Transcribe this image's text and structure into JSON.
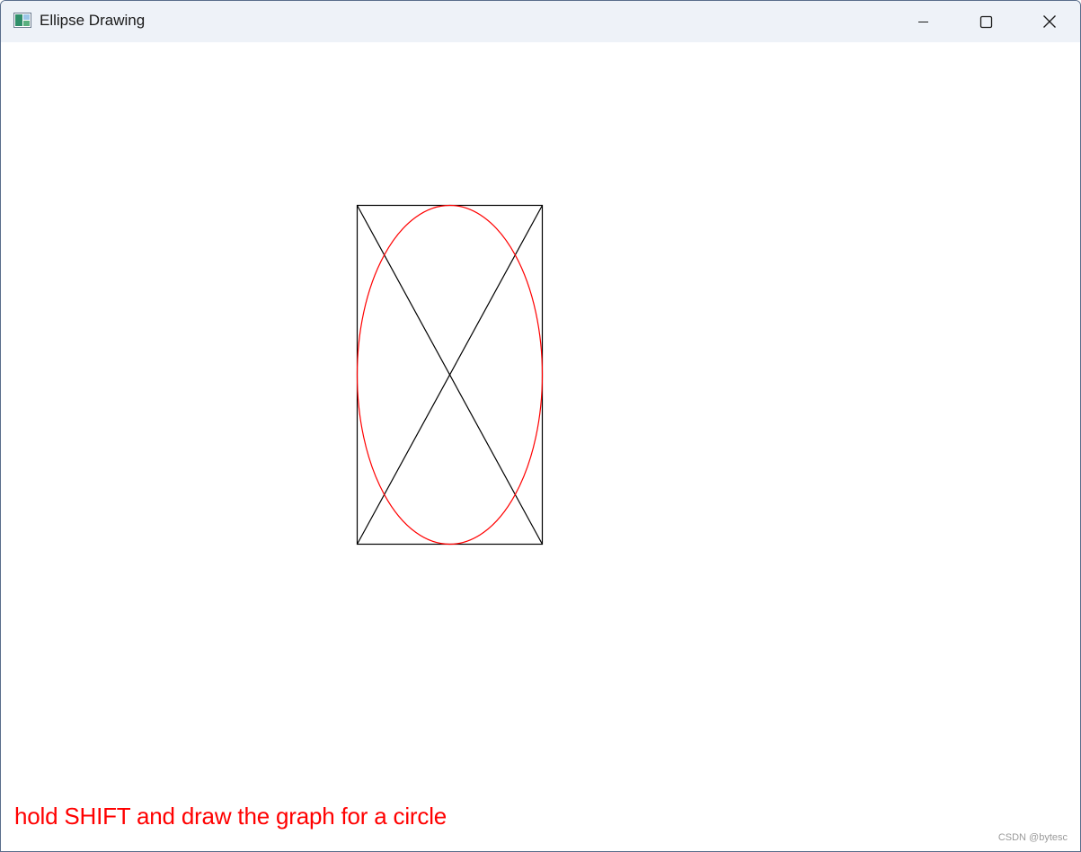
{
  "window": {
    "title": "Ellipse Drawing",
    "app_icon": "app-window-icon",
    "controls": {
      "minimize_icon": "minimize-icon",
      "maximize_icon": "maximize-icon",
      "close_icon": "close-icon"
    }
  },
  "canvas": {
    "hint_text": "hold SHIFT and draw the graph for a circle",
    "watermark": "CSDN @bytesc",
    "colors": {
      "ellipse": "#ff0000",
      "bounding_box": "#000000",
      "diagonals": "#000000",
      "hint": "#ff0000"
    }
  }
}
